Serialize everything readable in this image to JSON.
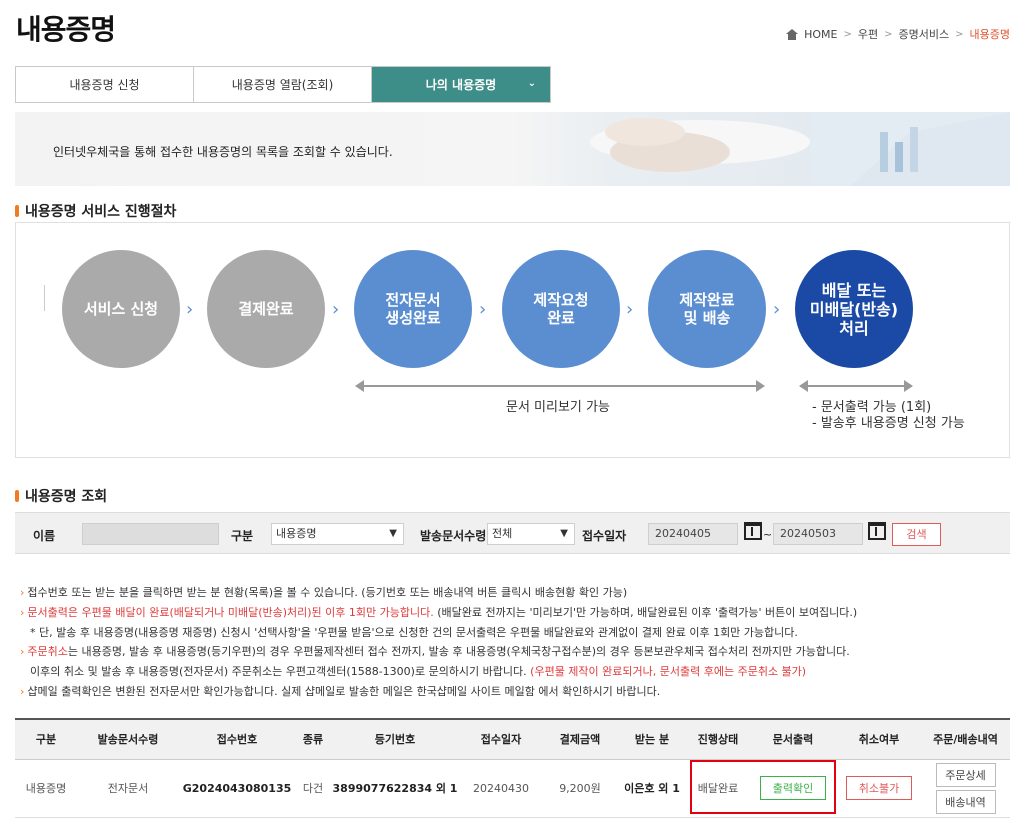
{
  "header": {
    "title": "내용증명",
    "breadcrumb": [
      "HOME",
      "우편",
      "증명서비스",
      "내용증명"
    ],
    "breadcrumb_sep": ">"
  },
  "tabs": [
    {
      "label": "내용증명 신청",
      "active": false
    },
    {
      "label": "내용증명 열람(조회)",
      "active": false
    },
    {
      "label": "나의 내용증명",
      "active": true
    }
  ],
  "banner": {
    "text": "인터넷우체국을 통해 접수한 내용증명의 목록을 조회할 수 있습니다."
  },
  "process": {
    "title": "내용증명 서비스 진행절차",
    "steps": [
      "서비스 신청",
      "결제완료",
      "전자문서\n생성완료",
      "제작요청\n완료",
      "제작완료\n및 배송",
      "배달 또는\n미배달(반송)\n처리"
    ],
    "range1_label": "문서 미리보기 가능",
    "range2_line1": "- 문서출력 가능 (1회)",
    "range2_line2": "- 발송후 내용증명 신청 가능",
    "colors": {
      "gray": "#aaaaaa",
      "blue": "#5b8ed0",
      "dark": "#1a4aa6"
    }
  },
  "search": {
    "title": "내용증명 조회",
    "name_label": "이름",
    "category_label": "구분",
    "category_value": "내용증명",
    "doc_type_label": "발송문서수령",
    "doc_type_value": "전체",
    "date_label": "접수일자",
    "date_from": "20240405",
    "date_sep": "~",
    "date_to": "20240503",
    "search_button": "검색"
  },
  "notes": {
    "n1": "접수번호 또는 받는 분을 클릭하면 받는 분 현황(목록)을 볼 수 있습니다. (등기번호 또는 배송내역 버튼 클릭시 배송현황 확인 가능)",
    "n2_red": "문서출력은 우편물 배달이 완료(배달되거나 미배달(반송)처리)된 이후 1회만 가능합니다.",
    "n2_rest": " (배달완료 전까지는 '미리보기'만 가능하며, 배달완료된 이후 '출력가능' 버튼이 보여집니다.)",
    "n3": "* 단, 발송 후 내용증명(내용증명 재증명) 신청시 '선택사항'을 '우편물 받음'으로 신청한 건의 문서출력은 우편물 배달완료와 관계없이 결제 완료 이후 1회만 가능합니다.",
    "n4_red": "주문취소",
    "n4_rest": "는 내용증명, 발송 후 내용증명(등기우편)의 경우 우편물제작센터 접수 전까지, 발송 후 내용증명(우체국창구접수분)의 경우 등본보관우체국 접수처리 전까지만 가능합니다.",
    "n5": "이후의 취소 및 발송 후 내용증명(전자문서) 주문취소는 우편고객센터(1588-1300)로 문의하시기 바랍니다. ",
    "n5_red": "(우편물 제작이 완료되거나, 문서출력 후에는 주문취소 불가)",
    "n6": "샵메일 출력확인은 변환된 전자문서만 확인가능합니다. 실제 샵메일로 발송한 메일은 한국샵메일 사이트 메일함 에서 확인하시기 바랍니다."
  },
  "table": {
    "headers": [
      "구분",
      "발송문서수령",
      "접수번호",
      "종류",
      "등기번호",
      "접수일자",
      "결제금액",
      "받는 분",
      "진행상태",
      "문서출력",
      "취소여부",
      "주문/배송내역"
    ],
    "row": {
      "category": "내용증명",
      "doc_type": "전자문서",
      "receipt_no": "G2024043080135",
      "kind": "다건",
      "reg_no": "3899077622834 외 1",
      "date": "20240430",
      "amount": "9,200원",
      "recipient": "이은호 외 1",
      "status": "배달완료",
      "print_button": "출력확인",
      "cancel_button": "취소불가",
      "order_detail_button": "주문상세",
      "delivery_button": "배송내역"
    }
  }
}
